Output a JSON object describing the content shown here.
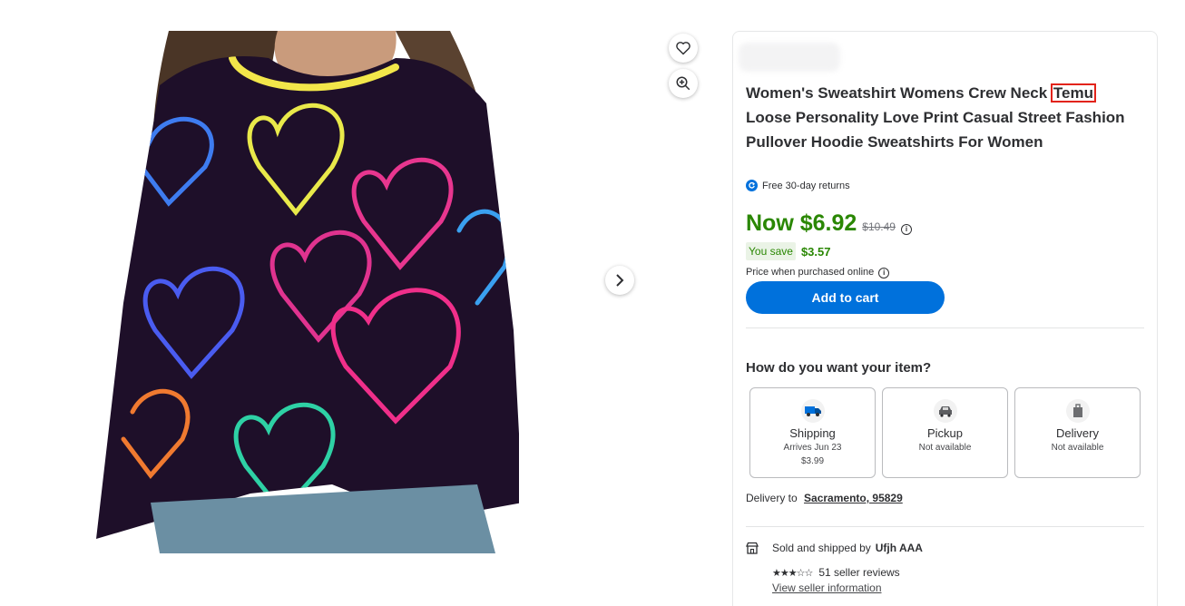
{
  "product": {
    "title_before": "Women's Sweatshirt Womens Crew Neck ",
    "title_highlight": "Temu",
    "title_after": " Loose Personality Love Print Casual Street Fashion Pullover Hoodie Sweatshirts For Women"
  },
  "returns": {
    "text": "Free 30-day returns",
    "icon": "returns-icon"
  },
  "price": {
    "now": "Now $6.92",
    "was": "$10.49",
    "you_save_label": "You save",
    "save_amount": "$3.57",
    "note": "Price when purchased online"
  },
  "cart": {
    "label": "Add to cart"
  },
  "fulfillment": {
    "heading": "How do you want your item?",
    "options": [
      {
        "name": "Shipping",
        "line1": "Arrives Jun 23",
        "line2": "$3.99",
        "icon": "shipping-truck-icon"
      },
      {
        "name": "Pickup",
        "line1": "Not available",
        "icon": "pickup-car-icon"
      },
      {
        "name": "Delivery",
        "line1": "Not available",
        "icon": "delivery-bag-icon"
      }
    ]
  },
  "delivery": {
    "label": "Delivery to",
    "location": "Sacramento, 95829"
  },
  "seller": {
    "label": "Sold and shipped by",
    "name": "Ufjh AAA",
    "rating_stars": "★★★☆☆",
    "reviews": "51 seller reviews",
    "info_link": "View seller information"
  },
  "colors": {
    "accent": "#0071dc",
    "price_green": "#2a8703",
    "highlight_red": "#e2231a"
  }
}
